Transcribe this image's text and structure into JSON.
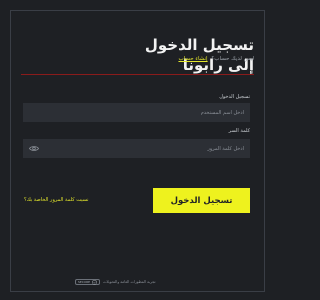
{
  "colors": {
    "background": "#1e2024",
    "accent": "#eef21e",
    "divider": "#8a1b1b",
    "field_bg": "#2c2f35"
  },
  "header": {
    "title": "تسجيل الدخول إلى رابونا",
    "signup_prompt": "ليس لديك حساب؟",
    "signup_link": "إنشاء حساب"
  },
  "form": {
    "username_label": "تسجيل الدخول",
    "username_placeholder": "أدخل اسم المستخدم",
    "password_label": "كلمة السر",
    "password_placeholder": "أدخل كلمة المرور",
    "password_toggle_icon": "eye-icon",
    "login_button": "تسجيل الدخول",
    "forgot_password": "نسيت كلمة المرور الخاصة بك؟"
  },
  "footer": {
    "text": "تجربة المطورات العامة والتحويلات",
    "badge_text": "SECURE",
    "badge_icon": "check-shield-icon"
  }
}
